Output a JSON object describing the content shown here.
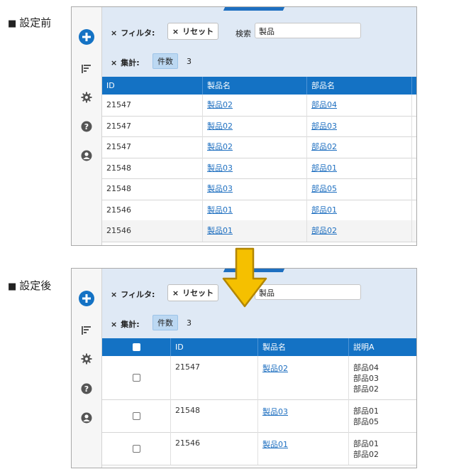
{
  "captions": {
    "before": "設定前",
    "after": "設定後",
    "bullet": "■"
  },
  "filter": {
    "close_glyph": "×",
    "filter_label": "フィルタ:",
    "reset_label": "リセット",
    "search_label": "検索",
    "search_value": "製品",
    "aggregate_label": "集計:",
    "aggregate_chip": "件数",
    "aggregate_value": "3"
  },
  "before": {
    "columns": [
      "ID",
      "製品名",
      "部品名"
    ],
    "rows": [
      {
        "id": "21547",
        "product": "製品02",
        "part": "部品04"
      },
      {
        "id": "21547",
        "product": "製品02",
        "part": "部品03"
      },
      {
        "id": "21547",
        "product": "製品02",
        "part": "部品02"
      },
      {
        "id": "21548",
        "product": "製品03",
        "part": "部品01"
      },
      {
        "id": "21548",
        "product": "製品03",
        "part": "部品05"
      },
      {
        "id": "21546",
        "product": "製品01",
        "part": "部品01"
      },
      {
        "id": "21546",
        "product": "製品01",
        "part": "部品02"
      }
    ]
  },
  "after": {
    "columns": [
      "ID",
      "製品名",
      "説明A"
    ],
    "rows": [
      {
        "id": "21547",
        "product": "製品02",
        "desc": [
          "部品04",
          "部品03",
          "部品02"
        ]
      },
      {
        "id": "21548",
        "product": "製品03",
        "desc": [
          "部品01",
          "部品05"
        ]
      },
      {
        "id": "21546",
        "product": "製品01",
        "desc": [
          "部品01",
          "部品02"
        ]
      }
    ]
  },
  "colors": {
    "accent": "#1472c4",
    "arrow": "#f5c000",
    "filter_bg": "#dfe9f5"
  },
  "icons": [
    "add-circle-icon",
    "sort-icon",
    "gear-icon",
    "help-icon",
    "user-icon",
    "down-arrow-icon"
  ]
}
